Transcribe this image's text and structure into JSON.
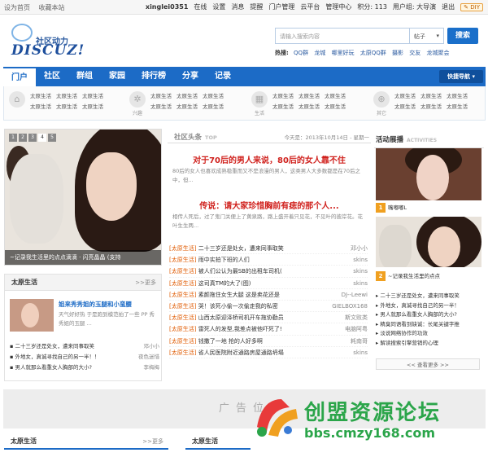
{
  "topbar": {
    "left_links": [
      "设为首页",
      "收藏本站"
    ],
    "username": "xinglei0351",
    "links": [
      "在线",
      "设置",
      "消息",
      "提醒",
      "门户管理",
      "云平台",
      "管理中心"
    ],
    "points": "积分: 113",
    "group": "用户组: 大导演",
    "logout": "退出",
    "diy": "DIY"
  },
  "logo": {
    "cn": "社区动力",
    "en": "DISCUZ!"
  },
  "search": {
    "placeholder": "请输入搜索内容",
    "type": "帖子",
    "button": "搜索"
  },
  "hot": {
    "label": "热搜:",
    "items": [
      "QQ群",
      "龙城",
      "哪里好玩",
      "太原QQ群",
      "摄影",
      "交友",
      "龙城聚会"
    ]
  },
  "nav": {
    "items": [
      "门户",
      "社区",
      "群组",
      "家园",
      "排行榜",
      "分享",
      "记录"
    ],
    "quick": "快捷导航"
  },
  "subnav": {
    "groups": [
      {
        "icon": "home-icon",
        "glyph": "⌂",
        "label": "",
        "links": [
          "太原生活",
          "太原生活",
          "太原生活",
          "太原生活",
          "太原生活",
          "太原生活"
        ]
      },
      {
        "icon": "pinwheel-icon",
        "glyph": "✲",
        "label": "兴趣",
        "links": [
          "太原生活",
          "太原生活",
          "太原生活",
          "太原生活",
          "太原生活",
          "太原生活"
        ]
      },
      {
        "icon": "building-icon",
        "glyph": "▦",
        "label": "生活",
        "links": [
          "太原生活",
          "太原生活",
          "太原生活",
          "太原生活",
          "太原生活",
          "太原生活"
        ]
      },
      {
        "icon": "target-icon",
        "glyph": "⊕",
        "label": "其它",
        "links": [
          "太原生活",
          "太原生活",
          "太原生活",
          "太原生活",
          "太原生活",
          "太原生活"
        ]
      }
    ]
  },
  "slider": {
    "nums": [
      "1",
      "2",
      "3",
      "4",
      "5"
    ],
    "caption": "~记录我生活里的点点滴滴 · 闪亮晶晶 (支持"
  },
  "taiyuan": {
    "title": "太原生活",
    "more": ">>更多",
    "thumb_title": "姐来秀秀姐的玉腿和小蛮腰",
    "thumb_desc": "天气好好热 于是跑到模范拍了一些 PP 秀秀姐的玉腿 ...",
    "items": [
      {
        "title": "二十三岁还是处女，遭来同事取笑",
        "author": "邓小小"
      },
      {
        "title": "外地女，真诚寻找自己的另一半！！",
        "author": "夜色迷惜"
      },
      {
        "title": "男人就那么看重女人胸部的大小?",
        "author": "李梅梅"
      }
    ]
  },
  "headlines": {
    "title": "社区头条",
    "title_en": "TOP",
    "date": "今天是：2013年10月14日 - 星期一",
    "h1": "对于70后的男人来说，80后的女人靠不住",
    "d1": "80后的女人也喜欢成熟稳重而又不是浪漫的男人，这类男人大多数都是在70后之中，但...",
    "h2": "传说：请大家珍惜胸前有痣的那个人...",
    "d2": "相传人死后，过了鬼门关便上了黄泉路，路上盛开着只见花，不见叶的彼岸花。花叶生生两...",
    "list": [
      {
        "cat": "[太原生活]",
        "title": "二十三岁还是处女，遭来同事取笑",
        "author": "邓小小"
      },
      {
        "cat": "[太原生活]",
        "title": "雨中实拍下班的人们",
        "author": "skins"
      },
      {
        "cat": "[太原生活]",
        "title": "被人们公认为最SB的出租车司机(",
        "author": "skins"
      },
      {
        "cat": "[太原生活]",
        "title": "这司真TM的大了(图)",
        "author": "skins"
      },
      {
        "cat": "[太原生活]",
        "title": "素颜拖住女生大腿 这是卖花还是",
        "author": "DJ--Leewi"
      },
      {
        "cat": "[太原生活]",
        "title": "哭！该死小偷一次偷走我的私密",
        "author": "GIELBOX168"
      },
      {
        "cat": "[太原生活]",
        "title": "山西太原迎泽桥司机开车拖协勤员",
        "author": "斯文败类"
      },
      {
        "cat": "[太原生活]",
        "title": "雷死人的发型,我差点被他吓死了!",
        "author": "电脑阿粤"
      },
      {
        "cat": "[太原生活]",
        "title": "钱撒了一地 抢的人好多啊",
        "author": "耗南哥"
      },
      {
        "cat": "[太原生活]",
        "title": "省人民医院附近通路房屋通路坍塌",
        "author": "skins"
      }
    ]
  },
  "activity": {
    "title": "活动展播",
    "title_en": "ACTIVITIES",
    "tag1": "1",
    "cap1": "嘴嘟嘟L",
    "tag2": "2",
    "cap2": "~记录我生活里的点点",
    "items": [
      "二十三岁还是处女，遭来同事取笑",
      "外地女，真诚寻找自己的另一半！",
      "男人就那么看重女人胸部的大小?",
      "精臭同语看到缺诚：长尾关键字推",
      "淡说网络协作的功效",
      "解读搜索引擎营销的心理"
    ],
    "more": "<< 查看更多 >>"
  },
  "ad": {
    "text": "广告位"
  },
  "bottom": {
    "left_title": "太原生活",
    "left_more": ">>更多",
    "right_title": "太原生活"
  },
  "watermark": {
    "title": "创盟资源论坛",
    "url": "bbs.cmzy168.com"
  }
}
